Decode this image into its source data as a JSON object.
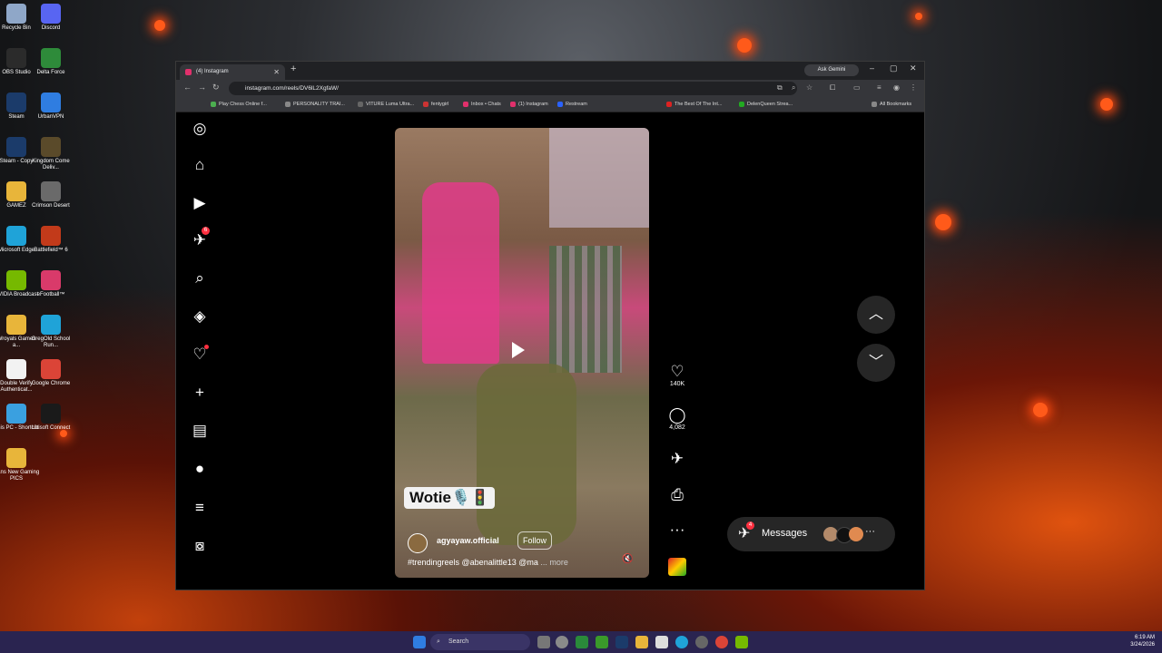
{
  "desktop": {
    "icons": [
      {
        "label": "Recycle Bin",
        "color": "#8fa7c8"
      },
      {
        "label": "Discord",
        "color": "#5865f2"
      },
      {
        "label": "OBS Studio",
        "color": "#2b2b2b"
      },
      {
        "label": "Delta Force",
        "color": "#2e8b3a"
      },
      {
        "label": "Steam",
        "color": "#1b3b6a"
      },
      {
        "label": "UrbanVPN",
        "color": "#2f7de1"
      },
      {
        "label": "Steam - Copy",
        "color": "#1b3b6a"
      },
      {
        "label": "Kingdom Come Deliv...",
        "color": "#5a4a2a"
      },
      {
        "label": "GAMEZ",
        "color": "#e8b53a"
      },
      {
        "label": "Crimson Desert",
        "color": "#6a6a6a"
      },
      {
        "label": "Microsoft Edge",
        "color": "#1fa3d8"
      },
      {
        "label": "Battlefield™ 6",
        "color": "#c23a1a"
      },
      {
        "label": "NVIDIA Broadcast",
        "color": "#76b900"
      },
      {
        "label": "eFootball™",
        "color": "#d93a6a"
      },
      {
        "label": "Wroyals Games a...",
        "color": "#e8b53a"
      },
      {
        "label": "GregOld School Run...",
        "color": "#1fa3d8"
      },
      {
        "label": "Double Verify Authenticat...",
        "color": "#f2f2f2"
      },
      {
        "label": "Google Chrome",
        "color": "#db4437"
      },
      {
        "label": "This PC - Shortcut",
        "color": "#3aa0e0"
      },
      {
        "label": "Ubisoft Connect",
        "color": "#1a1a1a"
      },
      {
        "label": "Dans New Gaming PICS",
        "color": "#e8b53a"
      }
    ]
  },
  "browser": {
    "tab_title": "(4) Instagram",
    "ask_gemini": "Ask Gemini",
    "url": "instagram.com/reels/DV6lL2XgfaW/",
    "bookmarks": [
      "Play Chess Online f...",
      "PERSONALITY TRAI...",
      "VITURE Luma Ultra...",
      "fentygirl",
      "Inbox • Chats",
      "(1) Instagram",
      "Restream",
      "The Best Of The Int...",
      "DelenQueen Strea...",
      "All Bookmarks"
    ]
  },
  "instagram": {
    "nav_badges": {
      "reels_count": "6"
    },
    "video": {
      "sticker_text": "Wotie🎙️🚦",
      "username": "agyayaw.official",
      "follow_label": "Follow",
      "caption": "#trendingreels @abenalittle13 @ma",
      "more_label": "... more"
    },
    "actions": {
      "likes": "140K",
      "comments": "4,082"
    },
    "messages": {
      "label": "Messages",
      "badge": "4"
    }
  },
  "taskbar": {
    "search_placeholder": "Search",
    "time": "6:19 AM",
    "date": "3/24/2026"
  }
}
